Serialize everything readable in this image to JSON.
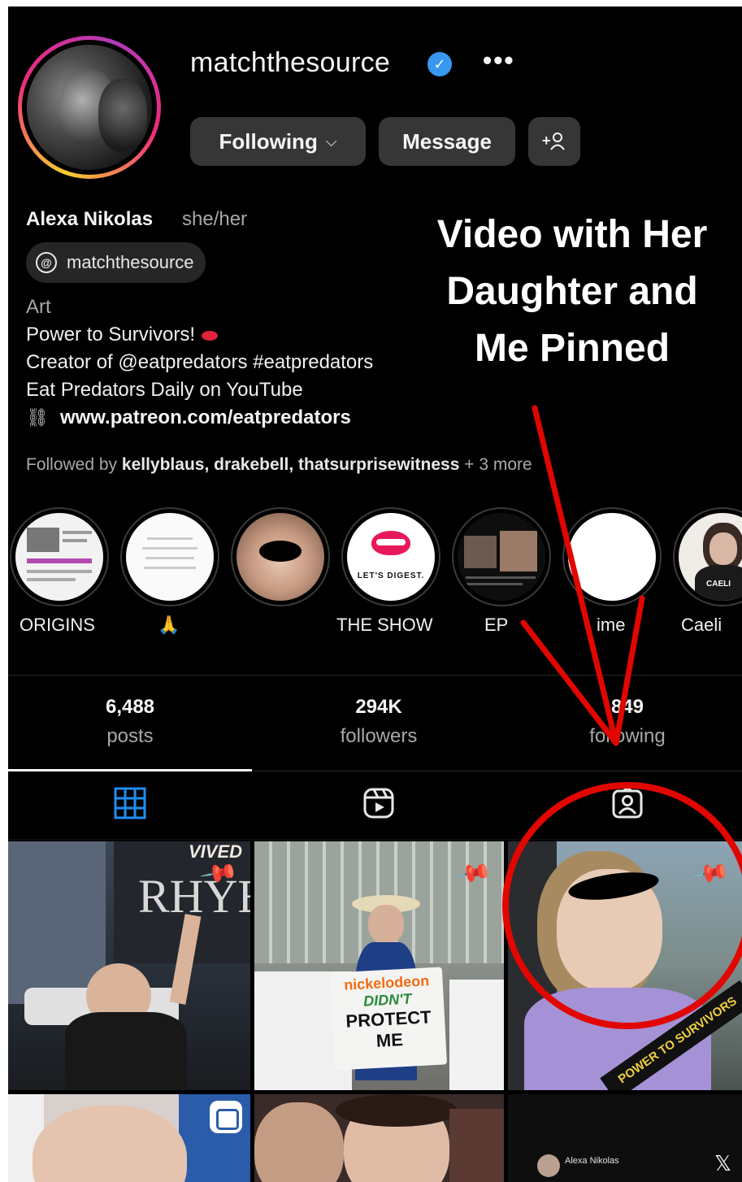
{
  "profile": {
    "username": "matchthesource",
    "more": "•••",
    "buttons": {
      "following": "Following",
      "message": "Message",
      "add_user": "+&#x1F464;"
    },
    "name": "Alexa Nikolas",
    "pronouns": "she/her",
    "threads_handle": "matchthesource",
    "category": "Art",
    "bio": [
      "Power to Survivors!",
      "Creator of @eatpredators #eatpredators",
      "Eat Predators Daily on YouTube"
    ],
    "link": "www.patreon.com/eatpredators",
    "followed_by_prefix": "Followed by ",
    "followed_by_names": "kellyblaus, drakebell, thatsurprisewitness",
    "followed_by_suffix": " + 3 more"
  },
  "annotation": {
    "lines": [
      "Video with Her",
      "Daughter and",
      "Me Pinned"
    ],
    "color": "#e10600"
  },
  "highlights": [
    {
      "label": "ORIGINS"
    },
    {
      "label": "🙏"
    },
    {
      "label": ""
    },
    {
      "label": "THE SHOW",
      "cover_text": "LET'S DIGEST."
    },
    {
      "label": "EP"
    },
    {
      "label": "ime"
    },
    {
      "label": "Caeli",
      "cover_text": "CAELI"
    }
  ],
  "stats": [
    {
      "value": "6,488",
      "label": "posts"
    },
    {
      "value": "294K",
      "label": "followers"
    },
    {
      "value": "849",
      "label": "following"
    }
  ],
  "grid": {
    "post1_sign": "RHYE",
    "post1_sign_top": "VIVED",
    "post2_sign": [
      "nickelodeon",
      "DIDN'T",
      "PROTECT",
      "ME"
    ],
    "post3_sash": "POWER TO SURVIVORS",
    "post6_name": "Alexa Nikolas"
  }
}
